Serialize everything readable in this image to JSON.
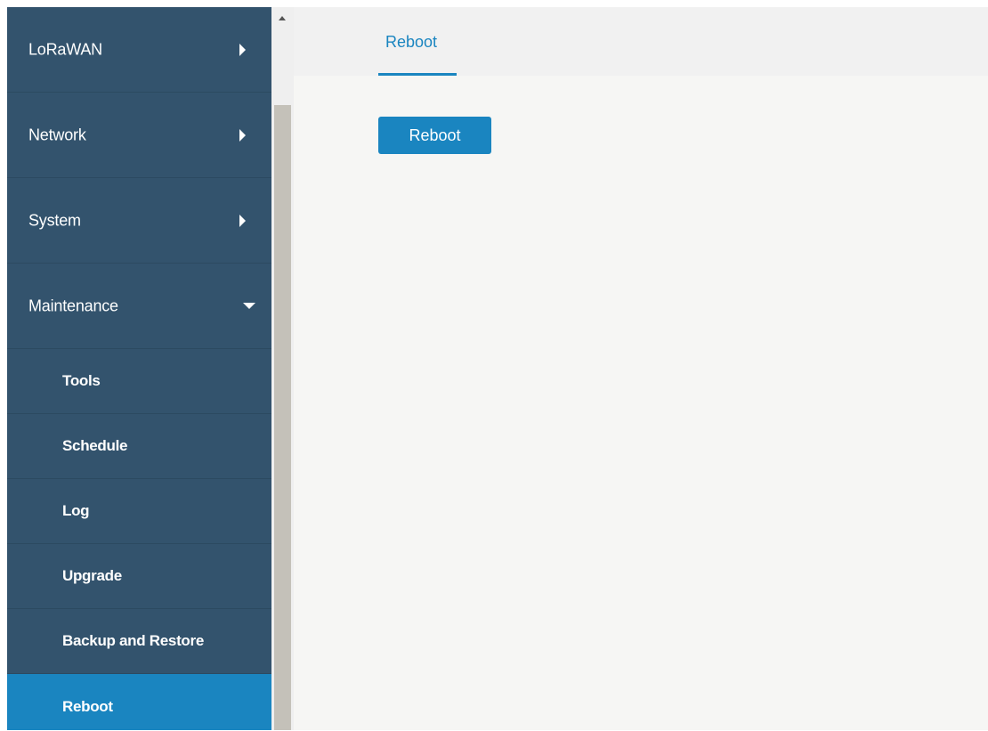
{
  "sidebar": {
    "menu": [
      {
        "label": "LoRaWAN",
        "icon": "chevron-right-icon"
      },
      {
        "label": "Network",
        "icon": "chevron-right-icon"
      },
      {
        "label": "System",
        "icon": "chevron-right-icon"
      },
      {
        "label": "Maintenance",
        "icon": "chevron-down-icon",
        "expanded": true
      }
    ],
    "submenu": [
      {
        "label": "Tools"
      },
      {
        "label": "Schedule"
      },
      {
        "label": "Log"
      },
      {
        "label": "Upgrade"
      },
      {
        "label": "Backup and Restore"
      },
      {
        "label": "Reboot",
        "active": true
      }
    ]
  },
  "main": {
    "tabs": [
      {
        "label": "Reboot",
        "active": true
      }
    ],
    "reboot_button_label": "Reboot"
  },
  "colors": {
    "sidebar_bg": "#33536d",
    "accent": "#1a85c0",
    "content_bg": "#f6f6f4",
    "tabbar_bg": "#f1f1f1",
    "scroll_thumb": "#c4c1b9"
  }
}
